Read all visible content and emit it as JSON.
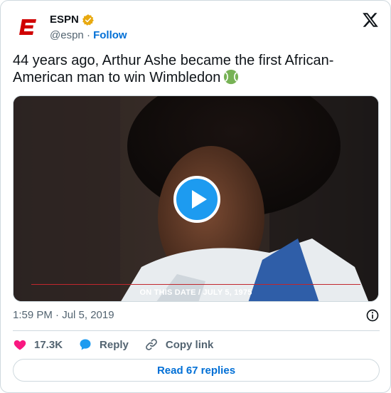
{
  "author": {
    "name": "ESPN",
    "handle": "@espn",
    "separator": "·",
    "follow_label": "Follow",
    "verified_color": "#e8a90f"
  },
  "tweet": {
    "text": "44 years ago, Arthur Ashe became the first African-American man to win Wimbledon",
    "emoji": "tennis-ball-icon"
  },
  "media": {
    "type": "video",
    "caption": "ON THIS DATE / JULY 5, 1975",
    "play_icon": "play-icon"
  },
  "meta": {
    "timestamp": "1:59 PM · Jul 5, 2019"
  },
  "actions": {
    "likes": "17.3K",
    "reply_label": "Reply",
    "copy_link_label": "Copy link"
  },
  "read_replies_label": "Read 67 replies",
  "colors": {
    "brand_red": "#d00000",
    "link_blue": "#006fd6",
    "like_pink": "#f91880",
    "reply_blue": "#1d9bf0",
    "muted": "#536471"
  }
}
